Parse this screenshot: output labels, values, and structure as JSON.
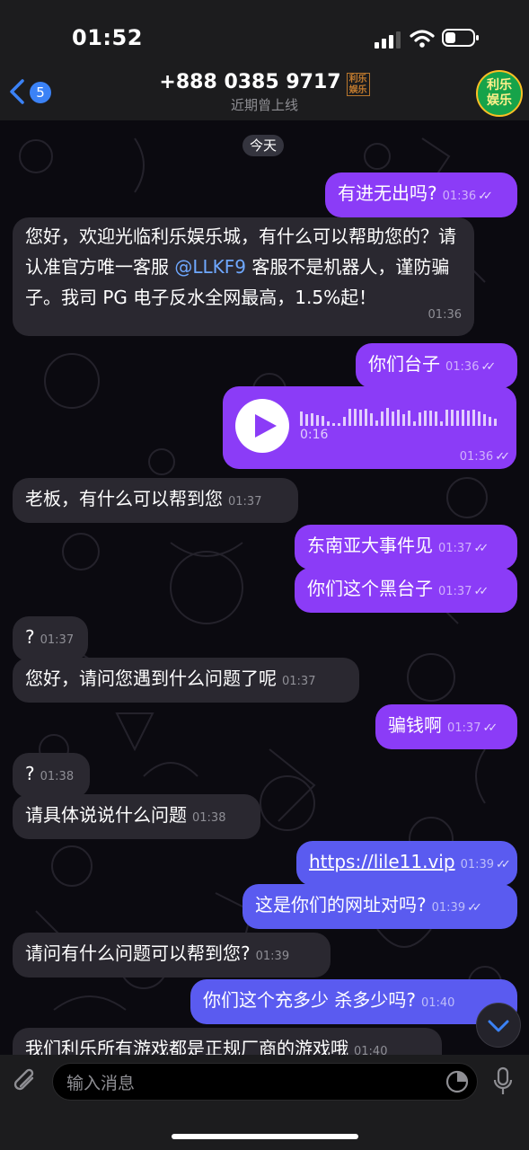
{
  "status": {
    "time": "01:52"
  },
  "header": {
    "back_badge": "5",
    "title": "+888 0385 9717",
    "title_seal": "利乐娱乐",
    "subtitle": "近期曾上线",
    "avatar_text": "利乐娱乐"
  },
  "chat": {
    "date_label": "今天",
    "messages": [
      {
        "dir": "out",
        "text": "有进无出吗?",
        "time": "01:36"
      },
      {
        "dir": "in",
        "text_before": "您好，欢迎光临利乐娱乐城，有什么可以帮助您的？请认准官方唯一客服 ",
        "mention": "@LLKF9",
        "text_after": " 客服不是机器人，谨防骗子。我司 PG 电子反水全网最高，1.5%起！",
        "time": "01:36"
      },
      {
        "dir": "out",
        "text": "你们台子",
        "time": "01:36"
      },
      {
        "dir": "out",
        "type": "voice",
        "duration": "0:16",
        "time": "01:36"
      },
      {
        "dir": "in",
        "text": "老板，有什么可以帮到您",
        "time": "01:37"
      },
      {
        "dir": "out",
        "text": "东南亚大事件见",
        "time": "01:37"
      },
      {
        "dir": "out",
        "text": "你们这个黑台子",
        "time": "01:37"
      },
      {
        "dir": "in",
        "text": "?",
        "time": "01:37"
      },
      {
        "dir": "in",
        "text": "您好，请问您遇到什么问题了呢",
        "time": "01:37"
      },
      {
        "dir": "out",
        "text": "骗钱啊",
        "time": "01:37"
      },
      {
        "dir": "in",
        "text": "?",
        "time": "01:38"
      },
      {
        "dir": "in",
        "text": "请具体说说什么问题",
        "time": "01:38"
      },
      {
        "dir": "out",
        "text": "https://lile11.vip",
        "time": "01:39",
        "link": true
      },
      {
        "dir": "out",
        "text": "这是你们的网址对吗?",
        "time": "01:39"
      },
      {
        "dir": "in",
        "text": "请问有什么问题可以帮到您?",
        "time": "01:39"
      },
      {
        "dir": "out",
        "text": "你们这个充多少  杀多少吗?",
        "time": "01:40"
      },
      {
        "dir": "in",
        "text": "我们利乐所有游戏都是正规厂商的游戏哦",
        "time": "01:40"
      }
    ]
  },
  "input": {
    "placeholder": "输入消息"
  },
  "icons": {
    "back": "chevron-left-icon",
    "attach": "paperclip-icon",
    "sticker": "sticker-icon",
    "mic": "microphone-icon",
    "scroll": "chevron-down-icon",
    "play": "play-icon"
  },
  "colors": {
    "outgoing_bubble": "#8b3cf7",
    "outgoing_bubble_alt": "#5a5bf0",
    "incoming_bubble": "#2a2830",
    "accent": "#3b82f6"
  }
}
